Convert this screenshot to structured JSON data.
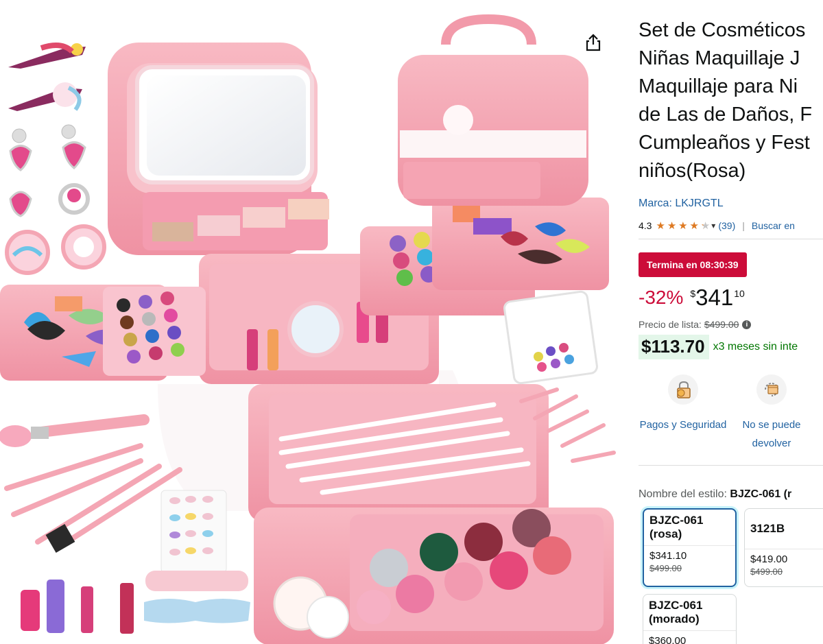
{
  "product": {
    "title_lines": [
      "Set de Cosméticos",
      "Niñas Maquillaje J",
      "Maquillaje para Ni",
      "de Las de Daños, F",
      "Cumpleaños y Fest",
      "niños(Rosa)"
    ],
    "brand_link": "Marca: LKJRGTL",
    "image_icon": "share-icon"
  },
  "rating": {
    "value": "4.3",
    "count": "(39)",
    "separator": "|",
    "search_link": "Buscar en",
    "stars_full": 4,
    "star_fraction": 0.3,
    "star_color": "#de7921"
  },
  "deal": {
    "badge": "Termina en 08:30:39",
    "badge_color": "#cc0c39"
  },
  "price": {
    "discount": "-32%",
    "symbol": "$",
    "whole": "341",
    "fraction": "10",
    "list_label": "Precio de lista:",
    "list_value": "$499.00",
    "info_icon": "i",
    "monthly_price": "$113.70",
    "monthly_text": "x3 meses sin inte"
  },
  "features": [
    {
      "label": "Pagos y Seguridad",
      "icon": "lock-icon"
    },
    {
      "label": "No se puede devolver",
      "icon": "no-return-icon"
    }
  ],
  "style": {
    "label": "Nombre del estilo:",
    "selected": "BJZC-061 (r",
    "options": [
      {
        "name": "BJZC-061 (rosa)",
        "price": "$341.10",
        "list": "$499.00",
        "selected": true
      },
      {
        "name": "3121B",
        "price": "$419.00",
        "list": "$499.00",
        "selected": false
      },
      {
        "name": "BJZC-061 (morado)",
        "price": "$360.00",
        "list": "",
        "selected": false
      }
    ]
  },
  "colors": {
    "link": "#2162a1",
    "deal_red": "#cc0c39",
    "monthly_green": "#007600",
    "monthly_bg": "#e3f6e9",
    "product_pink": "#f4a6b4"
  }
}
